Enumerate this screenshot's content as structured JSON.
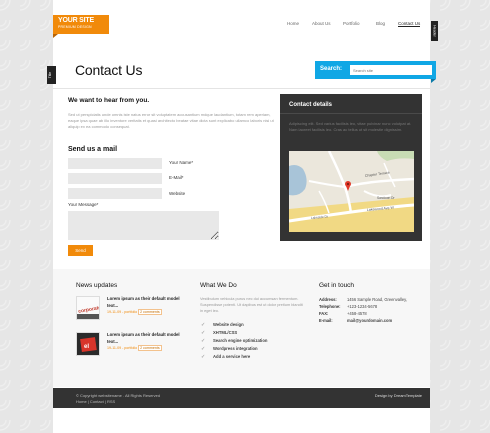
{
  "logo": {
    "title": "YOUR SITE",
    "subtitle": "PREMIUM DESIGN"
  },
  "nav": {
    "items": [
      {
        "label": "Home"
      },
      {
        "label": "About Us"
      },
      {
        "label": "Portfolio"
      },
      {
        "label": "Blog"
      },
      {
        "label": "Contact Us",
        "active": true
      }
    ]
  },
  "side_tabs": {
    "right": "Header",
    "left": "Title"
  },
  "page_title": "Contact Us",
  "search": {
    "label": "Search:",
    "placeholder": "Search site"
  },
  "intro": {
    "heading": "We want to hear from you.",
    "text": "Sed ut perspiciatis unde omnis iste natus error sit voluptatem accusantium mdque laudantium, totam rem aperiam, eaque ipsa quae ab illo inventore veritatis et quasi architecto beatae vitae dicta sunt explicabo ullamco laboris nisi ut aliquip ex ea commodo consequat."
  },
  "form": {
    "heading": "Send us a mail",
    "name_label": "Your Name*",
    "email_label": "E-Mail*",
    "website_label": "Website",
    "message_label": "Your Message*",
    "send_label": "Send"
  },
  "contact_details": {
    "title": "Contact details",
    "text": "Adipiscing elit. Sed varius facilisis leo, vitae pulvinar nunc volutpat at. Nam laoreet facilisis leo. Cras ac tellus ut sit molestie dignissim.",
    "map_labels": [
      "Chapter Terrace",
      "Sandown Dr",
      "Lakewood Ave W",
      "Lakeside Dr"
    ]
  },
  "news": {
    "title": "News updates",
    "items": [
      {
        "text": "Lorem ipsum as their default model text...",
        "date": "19-11-09 - portfolio",
        "comments": "2 comments",
        "thumb": "corporate"
      },
      {
        "text": "Lorem ipsum as their default model text...",
        "date": "19-11-09 - portfolio",
        "comments": "2 comments",
        "thumb": "el"
      }
    ]
  },
  "what_we_do": {
    "title": "What We Do",
    "text": "Vestibulum vehicula purus nec dui accumsan fermentum. Suspendisse potenti. Ut dapibus est ut dolor pretium blandit in eget leo.",
    "items": [
      "Website design",
      "XHTML/CSS",
      "Search engine optimization",
      "Wordpress integration",
      "Add a service here"
    ]
  },
  "get_in_touch": {
    "title": "Get in touch",
    "rows": [
      {
        "k": "Address:",
        "v": "1456 Sample Road, Greenvalley,"
      },
      {
        "k": "Telephone:",
        "v": "+123-1234-5678"
      },
      {
        "k": "FAX:",
        "v": "+458-4578"
      },
      {
        "k": "E-mail:",
        "v": "mail@yourdomain.com"
      }
    ]
  },
  "footer": {
    "copyright": "© Copyright websitename . All Rights Reserved",
    "links": "Home | Contact | RSS",
    "design_by": "Design by DreamTemplate"
  },
  "colors": {
    "accent": "#f18a0a",
    "search": "#10a7e5",
    "dark": "#333333"
  }
}
